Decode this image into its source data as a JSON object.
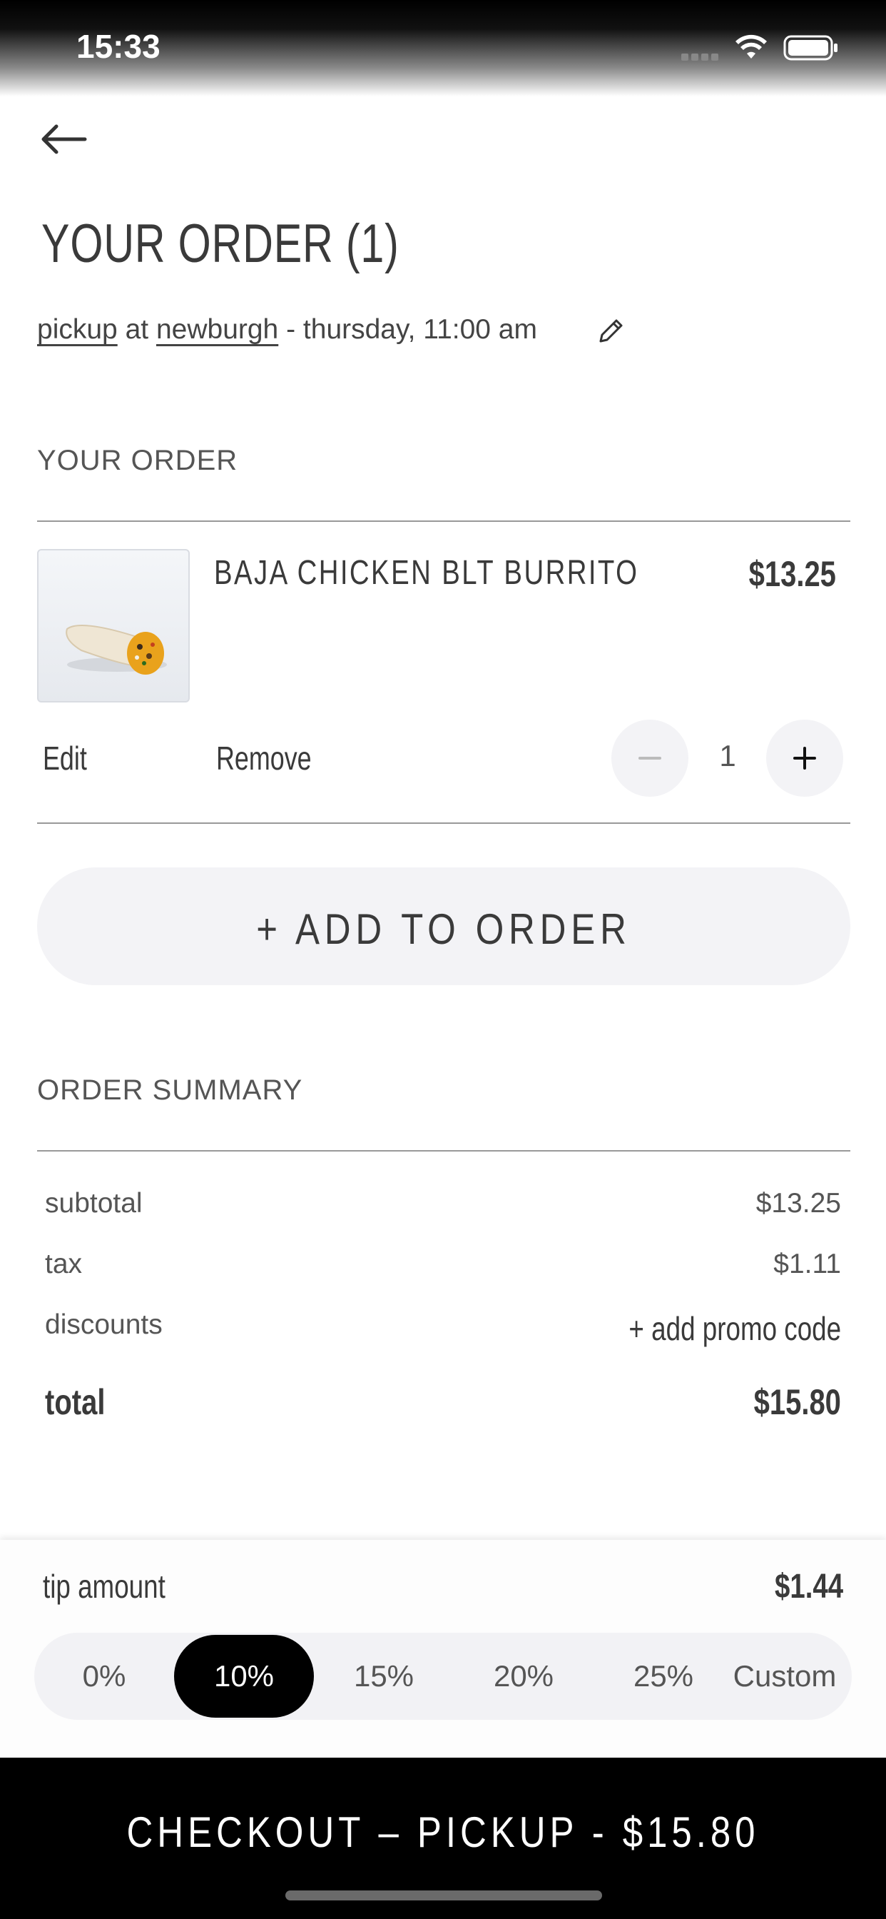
{
  "status_bar": {
    "time": "15:33"
  },
  "header": {
    "title": "YOUR ORDER (1)"
  },
  "pickup_info": {
    "mode": "pickup",
    "at": "at",
    "location": "newburgh",
    "time": "- thursday, 11:00 am"
  },
  "order_section": {
    "label": "YOUR ORDER",
    "item": {
      "name": "BAJA CHICKEN BLT BURRITO",
      "price": "$13.25",
      "quantity": "1",
      "edit_label": "Edit",
      "remove_label": "Remove"
    },
    "add_button_label": "+ ADD TO ORDER"
  },
  "summary": {
    "label": "ORDER SUMMARY",
    "subtotal_label": "subtotal",
    "subtotal_value": "$13.25",
    "tax_label": "tax",
    "tax_value": "$1.11",
    "discounts_label": "discounts",
    "promo_label": "+ add promo code",
    "total_label": "total",
    "total_value": "$15.80"
  },
  "tip": {
    "label": "tip amount",
    "value": "$1.44",
    "options": [
      "0%",
      "10%",
      "15%",
      "20%",
      "25%",
      "Custom"
    ],
    "selected": "10%"
  },
  "checkout": {
    "label": "CHECKOUT – PICKUP - $15.80"
  }
}
